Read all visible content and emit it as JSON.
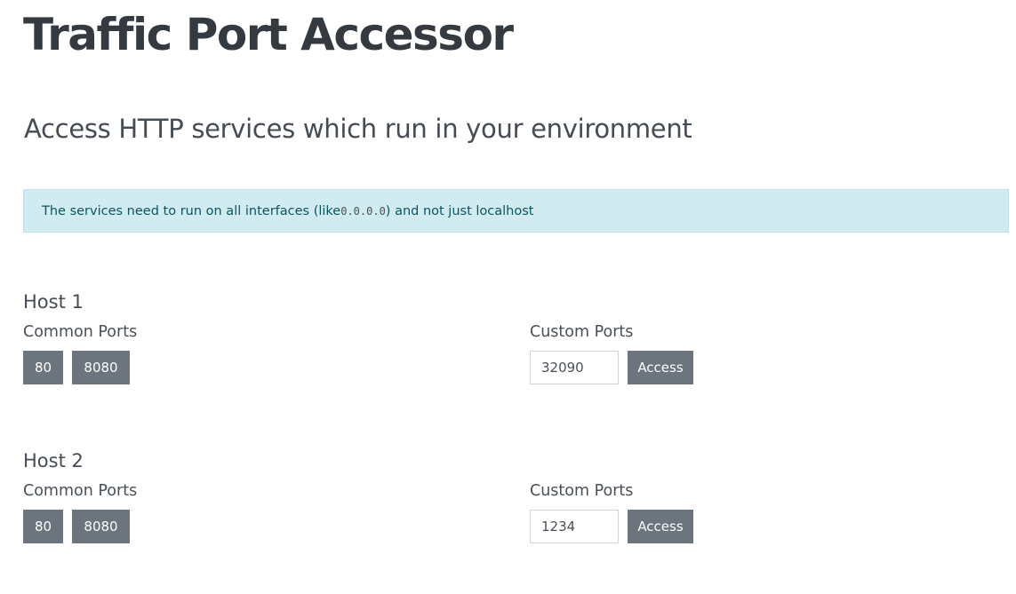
{
  "page": {
    "title": "Traffic Port Accessor",
    "subtitle": "Access HTTP services which run in your environment"
  },
  "alert": {
    "text_before": "The services need to run on all interfaces (like ",
    "code": "0.0.0.0",
    "text_after": ") and not just localhost"
  },
  "hosts": [
    {
      "title": "Host 1",
      "common_ports_label": "Common Ports",
      "common_ports": [
        "80",
        "8080"
      ],
      "custom_ports_label": "Custom Ports",
      "custom_port_value": "32090",
      "access_label": "Access"
    },
    {
      "title": "Host 2",
      "common_ports_label": "Common Ports",
      "common_ports": [
        "80",
        "8080"
      ],
      "custom_ports_label": "Custom Ports",
      "custom_port_value": "1234",
      "access_label": "Access"
    }
  ]
}
